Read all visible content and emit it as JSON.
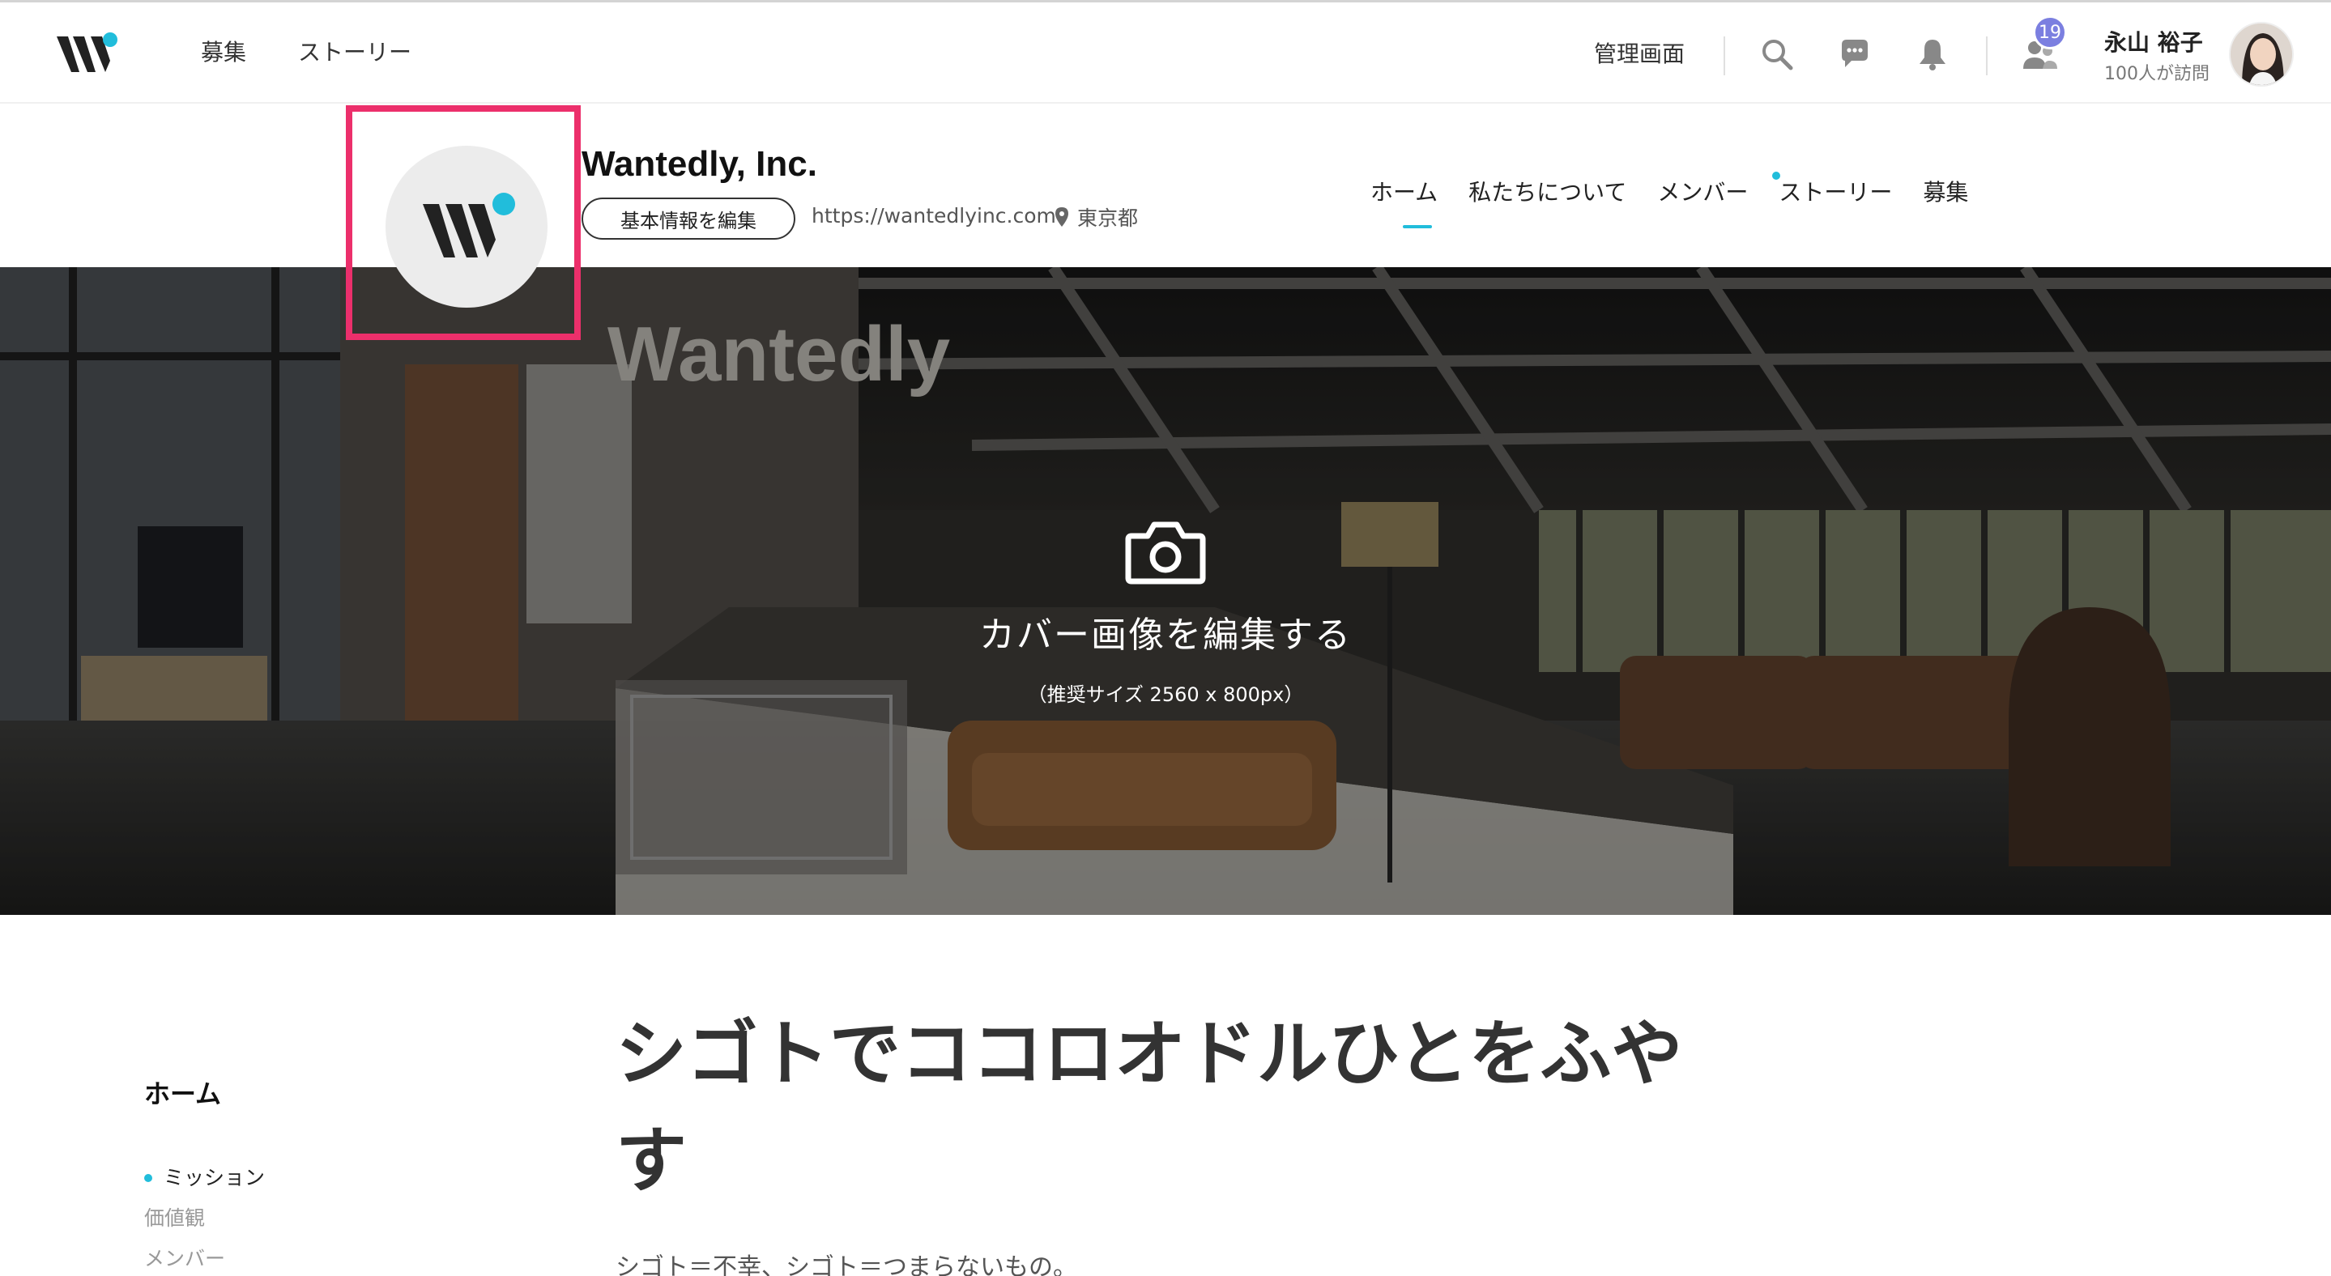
{
  "global_header": {
    "nav": [
      "募集",
      "ストーリー"
    ],
    "admin_label": "管理画面",
    "notification_badge": "19",
    "user_name": "永山 裕子",
    "user_visits": "100人が訪問"
  },
  "company": {
    "name": "Wantedly, Inc.",
    "edit_button": "基本情報を編集",
    "url": "https://wantedlyinc.com",
    "location": "東京都",
    "tabs": [
      "ホーム",
      "私たちについて",
      "メンバー",
      "ストーリー",
      "募集"
    ],
    "active_tab": "ホーム"
  },
  "cover": {
    "edit_label": "カバー画像を編集する",
    "size_hint": "（推奨サイズ 2560 x 800px）",
    "wall_text": "Wantedly"
  },
  "side_nav": {
    "title": "ホーム",
    "items": [
      "ミッション",
      "価値観",
      "メンバー"
    ],
    "active_item": "ミッション"
  },
  "main": {
    "mission_title": "シゴトでココロオドルひとをふやす",
    "mission_text": "シゴト＝不幸、シゴト＝つまらないもの。"
  },
  "colors": {
    "accent": "#21bddb",
    "highlight_box": "#ec2f6b",
    "badge": "#7b7fe0"
  }
}
